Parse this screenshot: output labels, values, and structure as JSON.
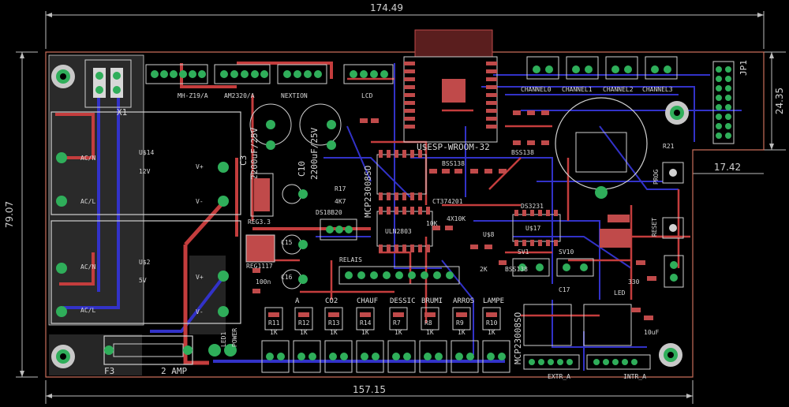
{
  "dimensions": {
    "top_width": "174.49",
    "bottom_width": "157.15",
    "left_height": "79.07",
    "right_height": "24.35",
    "right_inset": "17.42"
  },
  "board_text": {
    "x1": "X1",
    "mhz19": "MH-Z19/A",
    "am2320": "AM2320/A",
    "nextion": "NEXTION",
    "lcd": "LCD",
    "esp": "U$ESP-WROOM-32",
    "channels": [
      "CHANNEL0",
      "CHANNEL1",
      "CHANNEL2",
      "CHANNEL3"
    ],
    "jp1": "JP1",
    "prog": "PROG",
    "reset": "RESET",
    "ds3231": "DS3231",
    "u17": "U$17",
    "u14": "U$14",
    "u14_val": "12V",
    "u2": "U$2",
    "u2_val": "5V",
    "acn": "AC/N",
    "acl": "AC/L",
    "c3": "C3",
    "c3_val": "2200uF/25V",
    "c10": "C10",
    "c10_val": "2200uF/25V",
    "reg33": "REG3.3",
    "reg1117": "REG1117",
    "ds18b20": "DS18B20",
    "mcp": "MCP23008SO",
    "mcp2": "MCP23008SO",
    "uln": "ULN2803",
    "relais": "RELAIS",
    "r17": "R17",
    "r17_val": "4K7",
    "fuse": "F3",
    "fuse_val": "2 AMP",
    "led1": "LED1",
    "power": "POWER",
    "extr": "EXTR_A",
    "intr": "INTR_A",
    "relay_names": [
      "A",
      "CO2",
      "CHAUF",
      "DESSIC",
      "BRUMI",
      "ARROS",
      "LAMPE"
    ],
    "resistors": [
      "R11",
      "R12",
      "R13",
      "R14",
      "R7",
      "R8",
      "R9",
      "R10"
    ],
    "res_val": "1K",
    "bss": "BSS138",
    "sv1": "SV1",
    "sv10": "SV10",
    "r21": "R21",
    "misc_330": "330",
    "misc_4x10k": "4X10K",
    "misc_10k": "10K",
    "misc_100n": "100n",
    "misc_10uf": "10uF",
    "misc_2k": "2K",
    "ct": "CT374201",
    "u8": "U$8",
    "c15": "C15",
    "c16": "C16",
    "c17": "C17",
    "led": "LED"
  },
  "colors": {
    "bg": "#000000",
    "outline": "#c86d5a",
    "top_copper": "#c43d3d",
    "bottom_copper": "#3232c8",
    "pad": "#2fae5a",
    "silk": "#d0d0d0",
    "smd": "#c04a4a"
  }
}
